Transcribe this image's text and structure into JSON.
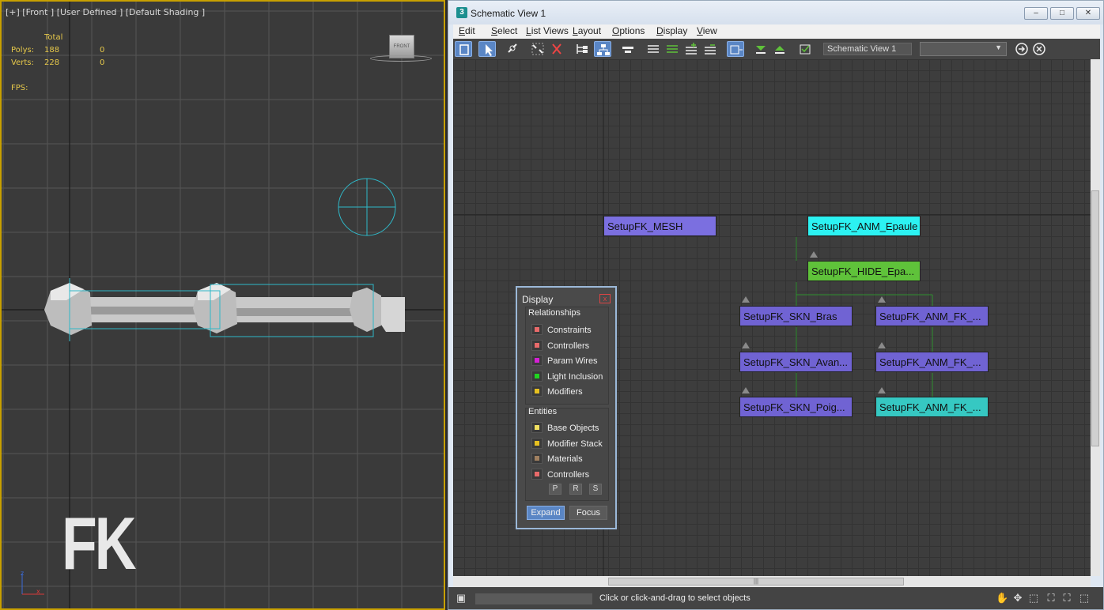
{
  "viewport": {
    "label": "[+] [Front ] [User Defined ] [Default Shading ]",
    "stats": {
      "total_label": "Total",
      "polys_label": "Polys:",
      "polys_value": "188",
      "polys_selected": "0",
      "verts_label": "Verts:",
      "verts_value": "228",
      "verts_selected": "0",
      "fps_label": "FPS:"
    },
    "viewcube_label": "FRONT",
    "overlay_text": "FK",
    "axis_labels": {
      "z": "z",
      "x": "x"
    }
  },
  "window": {
    "title": "Schematic View 1",
    "app_icon": "3",
    "controls": {
      "minimize": "–",
      "maximize": "□",
      "close": "✕"
    }
  },
  "menu": [
    "Edit",
    "Select",
    "List Views",
    "Layout",
    "Options",
    "Display",
    "View"
  ],
  "toolbar": {
    "view_name": "Schematic View 1",
    "view_combo_arrow": "▼",
    "icons": [
      "display-floater-icon",
      "select-icon",
      "connect-icon",
      "unlink-selected-icon",
      "delete-icon",
      "hierarchy-mode-icon",
      "references-mode-icon",
      "hide-icon",
      "align-left-icon",
      "align-top-icon",
      "insert-above-icon",
      "insert-below-icon",
      "preferences-icon",
      "collapse-icon",
      "expand-icon",
      "sync-selection-icon",
      "go-icon",
      "clear-icon"
    ]
  },
  "nodes": {
    "mesh": "SetupFK_MESH",
    "root": "SetupFK_ANM_Epaule",
    "hide": "SetupFK_HIDE_Epa...",
    "skn_bras": "SetupFK_SKN_Bras",
    "anm_1": "SetupFK_ANM_FK_...",
    "skn_avan": "SetupFK_SKN_Avan...",
    "anm_2": "SetupFK_ANM_FK_...",
    "skn_poig": "SetupFK_SKN_Poig...",
    "anm_3": "SetupFK_ANM_FK_..."
  },
  "display_panel": {
    "title": "Display",
    "close": "x",
    "relationships_label": "Relationships",
    "relationships": [
      {
        "label": "Constraints",
        "color": "#e86a6a"
      },
      {
        "label": "Controllers",
        "color": "#e86a6a"
      },
      {
        "label": "Param Wires",
        "color": "#d420d4"
      },
      {
        "label": "Light Inclusion",
        "color": "#20d420"
      },
      {
        "label": "Modifiers",
        "color": "#e6c020"
      }
    ],
    "entities_label": "Entities",
    "entities": [
      {
        "label": "Base Objects",
        "color": "#f0e060"
      },
      {
        "label": "Modifier Stack",
        "color": "#e6c020"
      },
      {
        "label": "Materials",
        "color": "#a08060"
      },
      {
        "label": "Controllers",
        "color": "#e86a6a"
      }
    ],
    "prs": [
      "P",
      "R",
      "S"
    ],
    "expand_label": "Expand",
    "focus_label": "Focus"
  },
  "status": {
    "text": "Click or click-and-drag to select objects",
    "scroll_grip": "|||"
  }
}
